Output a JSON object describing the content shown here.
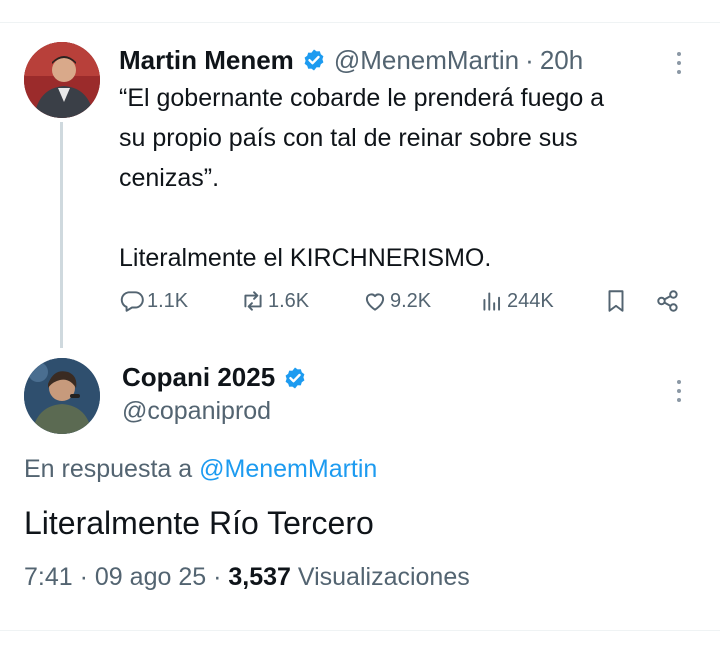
{
  "tweet": {
    "author_name": "Martin Menem",
    "author_handle": "@MenemMartin",
    "separator": "·",
    "time": "20h",
    "text_line1": "“El gobernante cobarde le prenderá fuego a",
    "text_line2": "su propio país con tal de reinar sobre sus",
    "text_line3": "cenizas”.",
    "text_line4": "Literalmente el KIRCHNERISMO.",
    "replies": "1.1K",
    "reposts": "1.6K",
    "likes": "9.2K",
    "views": "244K"
  },
  "reply": {
    "author_name": "Copani 2025",
    "author_handle": "@copaniprod",
    "in_reply_prefix": "En respuesta a",
    "in_reply_mention": "@MenemMartin",
    "text": "Literalmente Río Tercero",
    "time": "7:41",
    "date": "09 ago 25",
    "separator": "·",
    "views_count": "3,537",
    "views_label": "Visualizaciones"
  },
  "colors": {
    "verified": "#1d9bf0",
    "muted": "#536471",
    "link": "#1d9bf0"
  },
  "icons": [
    "verified-badge-icon",
    "more-options-icon",
    "reply-icon",
    "repost-icon",
    "like-icon",
    "views-icon",
    "bookmark-icon",
    "share-icon"
  ]
}
